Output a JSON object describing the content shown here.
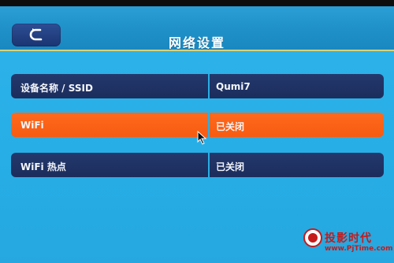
{
  "header": {
    "title": "网络设置",
    "back_icon": "back-arrow-icon"
  },
  "rows": [
    {
      "label": "设备名称 / SSID",
      "value": "Qumi7"
    },
    {
      "label": "WiFi",
      "value": "已关闭"
    },
    {
      "label": "WiFi 热点",
      "value": "已关闭"
    }
  ],
  "watermark": {
    "title": "投影时代",
    "url": "www.PjTime.com"
  },
  "colors": {
    "screen_bg": "#2fb3ea",
    "row_bg": "#1b2d5c",
    "selected_bg": "#ff6a1c"
  }
}
